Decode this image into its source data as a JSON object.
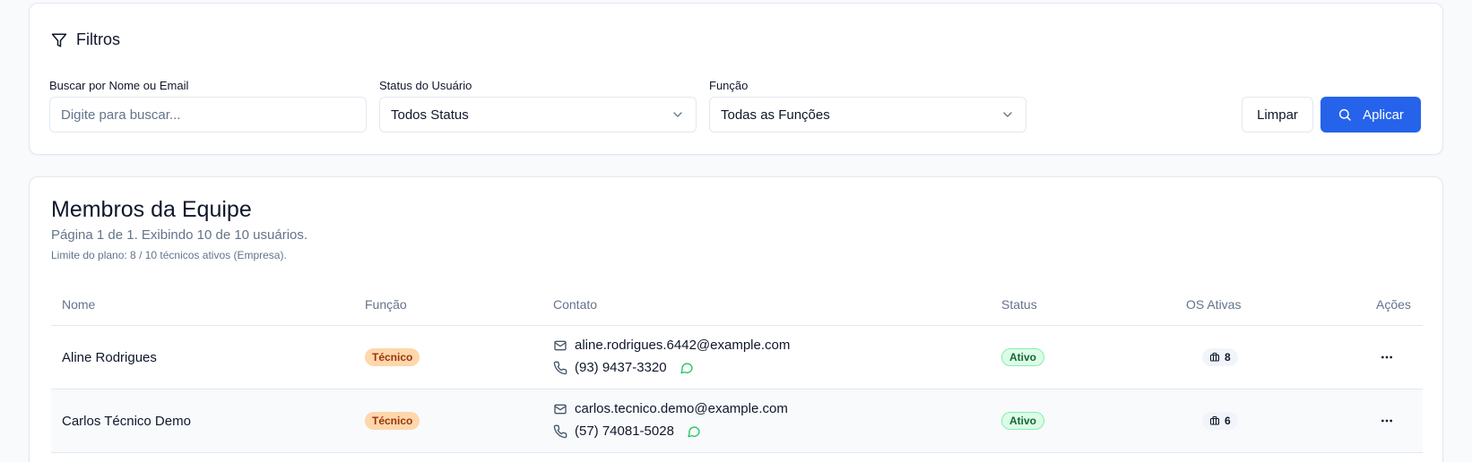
{
  "filters": {
    "title": "Filtros",
    "search": {
      "label": "Buscar por Nome ou Email",
      "placeholder": "Digite para buscar...",
      "value": ""
    },
    "status": {
      "label": "Status do Usuário",
      "value": "Todos Status"
    },
    "role": {
      "label": "Função",
      "value": "Todas as Funções"
    },
    "clear_label": "Limpar",
    "apply_label": "Aplicar",
    "accent_color": "#2563eb"
  },
  "team": {
    "title": "Membros da Equipe",
    "subtitle": "Página 1 de 1. Exibindo 10 de 10 usuários.",
    "limit": "Limite do plano: 8 / 10 técnicos ativos (Empresa).",
    "columns": [
      "Nome",
      "Função",
      "Contato",
      "Status",
      "OS Ativas",
      "Ações"
    ],
    "rows": [
      {
        "name": "Aline Rodrigues",
        "role": "Técnico",
        "email": "aline.rodrigues.6442@example.com",
        "phone": "(93) 9437-3320",
        "status": "Ativo",
        "os": "8"
      },
      {
        "name": "Carlos Técnico Demo",
        "role": "Técnico",
        "email": "carlos.tecnico.demo@example.com",
        "phone": "(57) 74081-5028",
        "status": "Ativo",
        "os": "6"
      }
    ]
  },
  "icons": {
    "filter": "funnel-icon",
    "chevron": "chevron-down-icon",
    "search": "search-icon",
    "mail": "mail-icon",
    "phone": "phone-icon",
    "whatsapp": "whatsapp-icon",
    "os": "briefcase-icon",
    "more": "more-horizontal-icon"
  }
}
